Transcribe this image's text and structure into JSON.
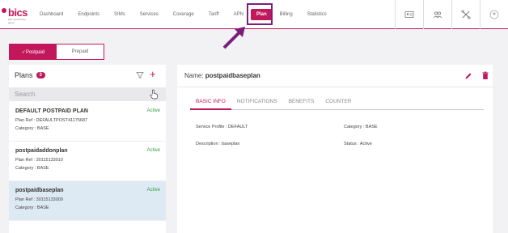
{
  "brand": {
    "logo_text": "bics",
    "logo_tagline": "part of proximus group",
    "accent": "#c2185b"
  },
  "nav": {
    "items": [
      "Dashboard",
      "Endpoints",
      "SIMs",
      "Services",
      "Coverage",
      "Tariff",
      "APN",
      "Plan",
      "Billing",
      "Statistics"
    ],
    "active": "Plan"
  },
  "top_icons": [
    "id-card-icon",
    "users-icon",
    "tools-icon",
    "user-avatar-icon"
  ],
  "toggle": {
    "postpaid_label": "✓Postpaid",
    "prepaid_label": "Prepaid",
    "selected": "Postpaid"
  },
  "plans": {
    "title": "Plans",
    "count": "3",
    "search_placeholder": "Search",
    "items": [
      {
        "name": "DEFAULT POSTPAID PLAN",
        "ref": "Plan Ref : DEFAULTPOST41175687",
        "category": "Category : BASE",
        "status": "Active"
      },
      {
        "name": "postpaidaddonplan",
        "ref": "Plan Ref : 30115133010",
        "category": "Category : BASE",
        "status": "Active"
      },
      {
        "name": "postpaidbaseplan",
        "ref": "Plan Ref : 30115133009",
        "category": "Category : BASE",
        "status": "Active"
      }
    ],
    "selected_index": 2
  },
  "detail": {
    "name_label": "Name: ",
    "name_value": "postpaidbaseplan",
    "tabs": [
      "BASIC INFO",
      "NOTIFICATIONS",
      "BENEFITS",
      "COUNTER"
    ],
    "active_tab": "BASIC INFO",
    "service_profile": "Service Profile : DEFAULT",
    "category": "Category : BASE",
    "description": "Description : baseplan",
    "status": "Status : Active"
  }
}
